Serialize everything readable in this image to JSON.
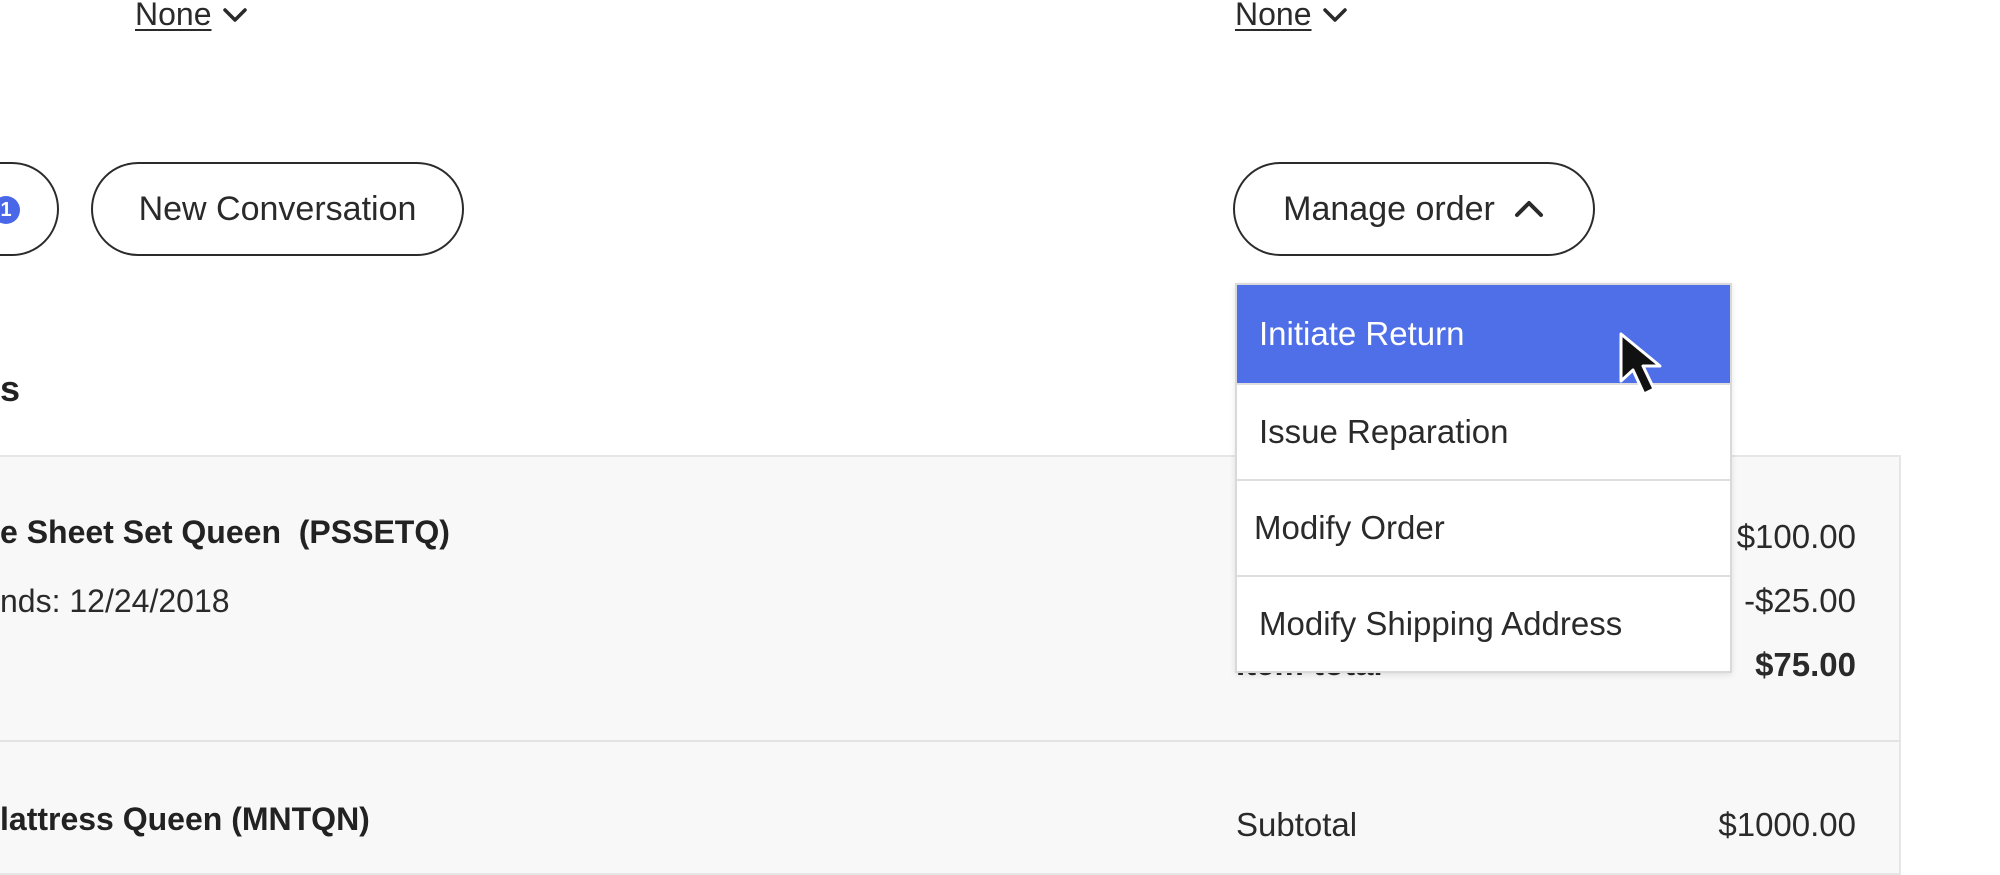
{
  "filters": {
    "left_value": "None",
    "right_value": "None"
  },
  "actions": {
    "badge_count": "1",
    "new_conversation_label": "New Conversation",
    "manage_order_label": "Manage order"
  },
  "manage_order_menu": {
    "items": [
      "Initiate Return",
      "Issue Reparation",
      "Modify Order",
      "Modify Shipping Address"
    ],
    "highlighted_index": 0,
    "highlight_color": "#4f6fe8"
  },
  "section": {
    "heading_fragment": "s"
  },
  "order_items": [
    {
      "name_fragment": "e Sheet Set Queen  (PSSETQ)",
      "meta_fragment": "nds: 12/24/2018",
      "price": "$100.00",
      "discount": "-$25.00",
      "total_label_fragment": "Item total",
      "total": "$75.00"
    },
    {
      "name_fragment": "lattress Queen (MNTQN)",
      "subtotal_label": "Subtotal",
      "subtotal": "$1000.00"
    }
  ],
  "icons": {
    "filter_chevron": "chevron-down-icon",
    "manage_chevron": "chevron-up-icon",
    "pointer": "mouse-pointer-icon"
  }
}
